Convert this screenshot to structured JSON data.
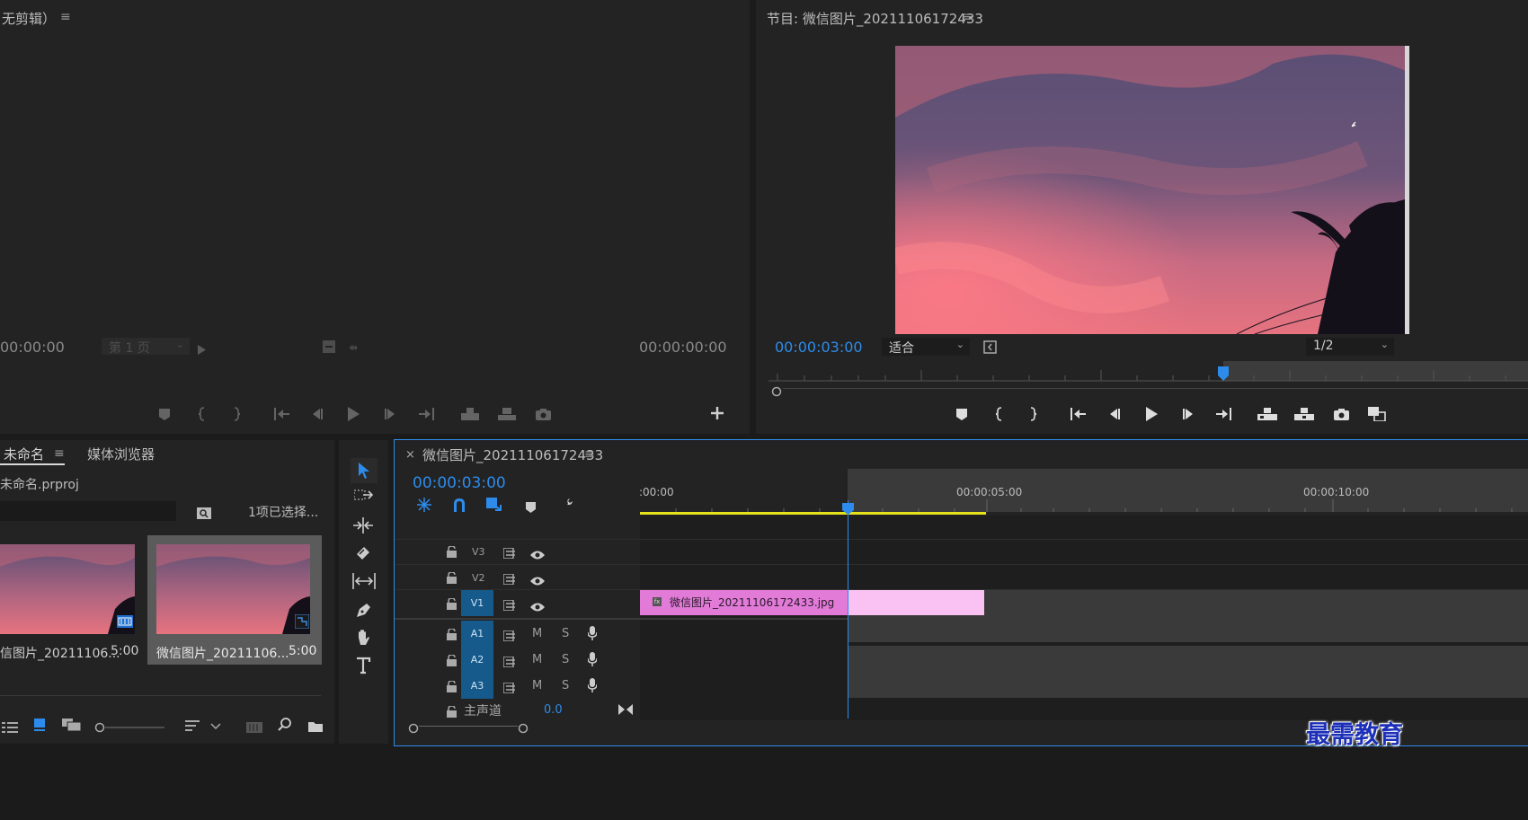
{
  "source_monitor": {
    "title": "无剪辑）",
    "timecode_left": "00:00:00",
    "page_select": "第 1 页",
    "timecode_right": "00:00:00:00"
  },
  "program_monitor": {
    "title": "节目: 微信图片_20211106172433",
    "timecode": "00:00:03:00",
    "fit": "适合",
    "resolution": "1/2"
  },
  "project": {
    "tab_active": "未命名",
    "tab_media_browser": "媒体浏览器",
    "project_file": "未命名.prproj",
    "selection_status": "1项已选择...",
    "items": [
      {
        "name": "信图片_20211106...",
        "duration": "5:00"
      },
      {
        "name": "微信图片_20211106...",
        "duration": "5:00"
      }
    ]
  },
  "timeline": {
    "sequence_title": "微信图片_20211106172433",
    "timecode": "00:00:03:00",
    "ruler": [
      ":00:00",
      "00:00:05:00",
      "00:00:10:00"
    ],
    "video_tracks": [
      "V3",
      "V2",
      "V1"
    ],
    "audio_tracks": [
      "A1",
      "A2",
      "A3"
    ],
    "mute_label": "M",
    "solo_label": "S",
    "master_label": "主声道",
    "master_value": "0.0",
    "clip_name": "微信图片_20211106172433.jpg",
    "clip_fx": "fx",
    "close_label": "×"
  },
  "watermark": "最需教育",
  "colors": {
    "accent": "#2d8ceb",
    "clip": "#e27ad8",
    "clip_light": "#f9c2f2",
    "work_area": "#e6e21c",
    "track_target": "#155a8a"
  }
}
